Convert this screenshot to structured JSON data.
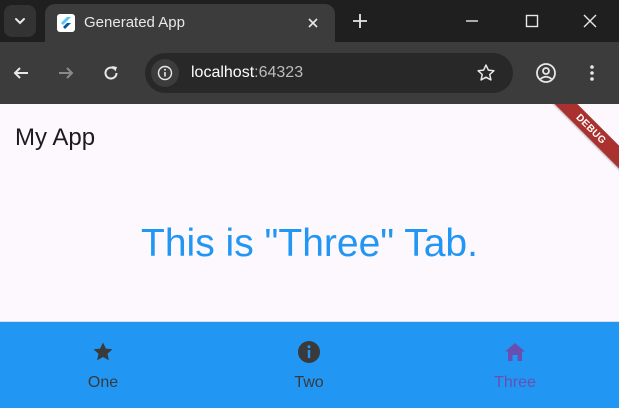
{
  "browser": {
    "tab_title": "Generated App",
    "url_host": "localhost",
    "url_port": ":64323"
  },
  "app": {
    "title": "My App",
    "debug_label": "DEBUG",
    "message": "This is \"Three\" Tab.",
    "colors": {
      "primary": "#2196f3",
      "selected": "#6a4fb3",
      "unselected": "#3a3a3a",
      "debug_banner": "#a9312f"
    },
    "bottom_nav": {
      "selected_index": 2,
      "items": [
        {
          "label": "One",
          "icon": "star-icon"
        },
        {
          "label": "Two",
          "icon": "info-icon"
        },
        {
          "label": "Three",
          "icon": "home-icon"
        }
      ]
    }
  }
}
